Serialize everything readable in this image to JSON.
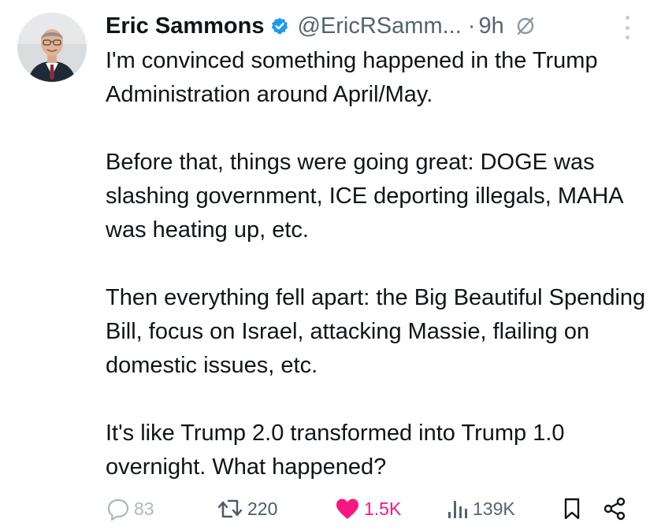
{
  "author": {
    "name": "Eric Sammons",
    "handle": "@EricRSamm...",
    "separator": "·",
    "time": "9h"
  },
  "tweet": {
    "paragraphs": [
      "I'm convinced something happened in the Trump Administration around April/May.",
      "Before that, things were going great: DOGE was slashing government, ICE deporting illegals, MAHA was heating up, etc.",
      "Then everything fell apart: the Big Beautiful Spending Bill, focus on Israel, attacking Massie, flailing on domestic issues, etc.",
      "It's like Trump 2.0 transformed into Trump 1.0 overnight. What happened?"
    ]
  },
  "actions": {
    "replies": "83",
    "retweets": "220",
    "likes": "1.5K",
    "views": "139K"
  },
  "colors": {
    "text": "#0f1419",
    "secondary": "#536471",
    "verified": "#1d9bf0",
    "like": "#f91880"
  },
  "icons": [
    "verified-badge-icon",
    "mute-icon",
    "more-options-icon",
    "reply-icon",
    "retweet-icon",
    "like-icon",
    "views-icon",
    "bookmark-icon",
    "share-icon"
  ]
}
